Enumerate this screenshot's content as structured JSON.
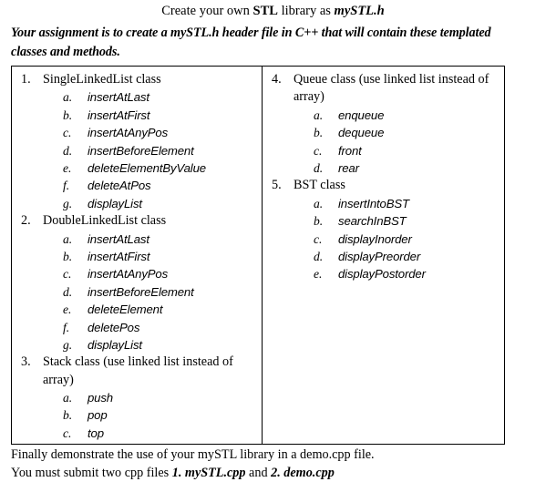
{
  "document": {
    "title": {
      "part1": "Create your own ",
      "part2_bold": "STL",
      "part3": " library as ",
      "part4_bold_italic": "mySTL.h"
    },
    "subtitle": {
      "part1": "Your assignment is to create a ",
      "part2_strong": "mySTL.h",
      "part3": " header file in C++ that will contain these ",
      "part4_strong": "templated classes and methods."
    },
    "footer": {
      "line1": "Finally demonstrate the use of your mySTL library in a demo.cpp file.",
      "line2_part1": "You must submit two cpp files ",
      "line2_file1": "1. mySTL.cpp",
      "line2_part2": " and ",
      "line2_file2": "2. demo.cpp"
    }
  },
  "table": {
    "left_column": [
      {
        "marker": "1.",
        "label": "SingleLinkedList class",
        "methods": [
          {
            "marker": "a.",
            "name": "insertAtLast"
          },
          {
            "marker": "b.",
            "name": "insertAtFirst"
          },
          {
            "marker": "c.",
            "name": "insertAtAnyPos"
          },
          {
            "marker": "d.",
            "name": "insertBeforeElement"
          },
          {
            "marker": "e.",
            "name": "deleteElementByValue"
          },
          {
            "marker": "f.",
            "name": "deleteAtPos"
          },
          {
            "marker": "g.",
            "name": "displayList"
          }
        ]
      },
      {
        "marker": "2.",
        "label": "DoubleLinkedList class",
        "methods": [
          {
            "marker": "a.",
            "name": "insertAtLast"
          },
          {
            "marker": "b.",
            "name": "insertAtFirst"
          },
          {
            "marker": "c.",
            "name": "insertAtAnyPos"
          },
          {
            "marker": "d.",
            "name": "insertBeforeElement"
          },
          {
            "marker": "e.",
            "name": "deleteElement"
          },
          {
            "marker": "f.",
            "name": "deletePos"
          },
          {
            "marker": "g.",
            "name": "displayList"
          }
        ]
      },
      {
        "marker": "3.",
        "label": "Stack class (use linked list instead of array)",
        "methods": [
          {
            "marker": "a.",
            "name": "push"
          },
          {
            "marker": "b.",
            "name": "pop"
          },
          {
            "marker": "c.",
            "name": "top"
          }
        ]
      }
    ],
    "right_column": [
      {
        "marker": "4.",
        "label": "Queue class (use linked list instead of array)",
        "methods": [
          {
            "marker": "a.",
            "name": "enqueue"
          },
          {
            "marker": "b.",
            "name": "dequeue"
          },
          {
            "marker": "c.",
            "name": "front"
          },
          {
            "marker": "d.",
            "name": "rear"
          }
        ]
      },
      {
        "marker": "5.",
        "label": "BST class",
        "methods": [
          {
            "marker": "a.",
            "name": "insertIntoBST"
          },
          {
            "marker": "b.",
            "name": "searchInBST"
          },
          {
            "marker": "c.",
            "name": "displayInorder"
          },
          {
            "marker": "d.",
            "name": "displayPreorder"
          },
          {
            "marker": "e.",
            "name": "displayPostorder"
          }
        ]
      }
    ]
  }
}
